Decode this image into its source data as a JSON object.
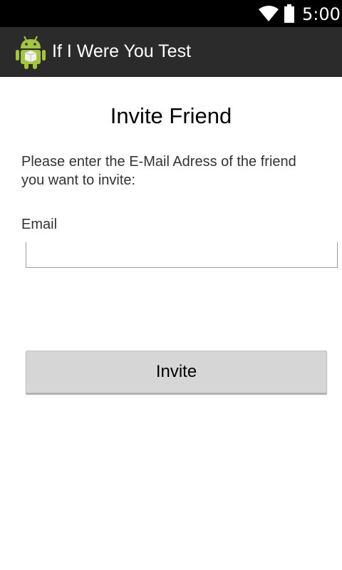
{
  "status_bar": {
    "time": "5:00",
    "wifi_icon": "wifi-icon",
    "battery_icon": "battery-icon"
  },
  "action_bar": {
    "app_icon": "android-icon",
    "title": "If I Were You Test"
  },
  "main": {
    "title": "Invite Friend",
    "instructions": "Please enter the E-Mail Adress of the friend you want to invite:",
    "email_label": "Email",
    "email_value": "",
    "email_placeholder": "",
    "invite_label": "Invite"
  },
  "colors": {
    "status_bar_bg": "#000000",
    "action_bar_bg": "#2b2b2b",
    "button_bg": "#d6d6d6",
    "android_green": "#a4c639"
  }
}
